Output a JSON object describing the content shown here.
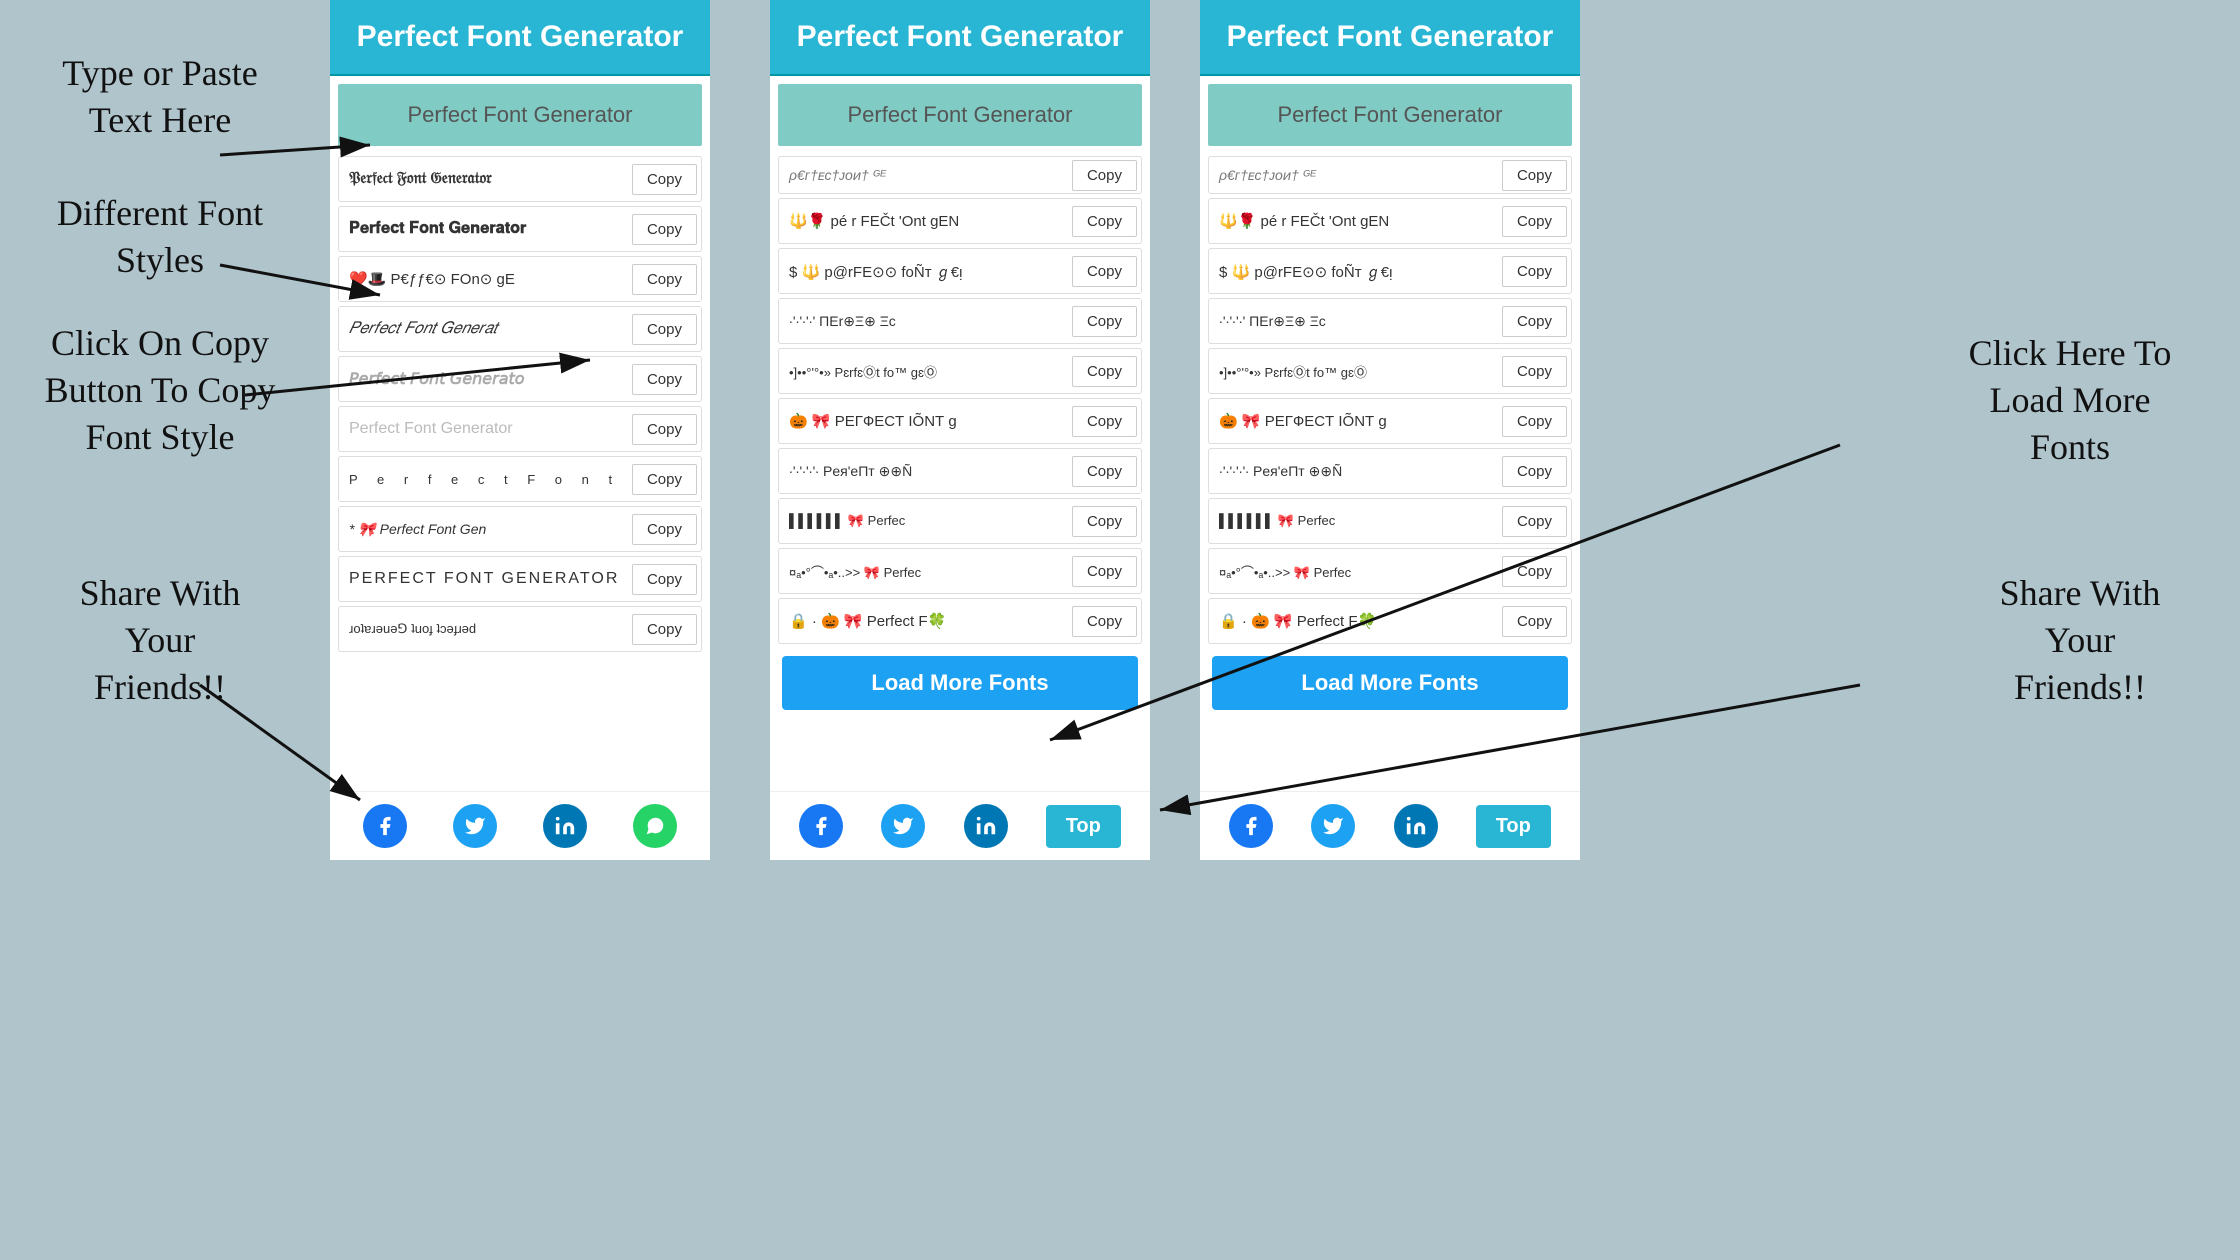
{
  "app": {
    "title": "Perfect Font Generator",
    "background_color": "#b0c4cc"
  },
  "annotations": {
    "type_paste": "Type or Paste Text\nHere",
    "different_fonts": "Different Font\nStyles",
    "click_copy": "Click On Copy\nButton To Copy\nFont Style",
    "share_left": "Share With\nYour\nFriends!!",
    "click_load": "Click Here To\nLoad More\nFonts",
    "share_right": "Share With\nYour\nFriends!!"
  },
  "left_panel": {
    "header": "Perfect Font Generator",
    "input_placeholder": "Perfect Font Generator",
    "font_rows": [
      {
        "text": "𝔓𝔢𝔯𝔣𝔢𝔠𝔱 𝔉𝔬𝔫𝔱 𝔊𝔢𝔫𝔢𝔯𝔞𝔱𝔬𝔯",
        "copy": "Copy",
        "style": "blackletter"
      },
      {
        "text": "𝐏𝐞𝐫𝐟𝐞𝐜𝐭 𝐅𝐨𝐧𝐭 𝐆𝐞𝐧𝐞𝐫𝐚𝐭𝐨𝐫",
        "copy": "Copy",
        "style": "bold"
      },
      {
        "text": "❤️🎩 P€ƒƒ€⊙ FOn⊙ gE",
        "copy": "Copy",
        "style": "emoji"
      },
      {
        "text": "𝑃𝑒𝑟𝑓𝑒𝑐𝑡 𝐹𝑜𝑛𝑡 𝐺𝑒𝑛𝑒𝑟𝑎𝑡",
        "copy": "Copy",
        "style": "italic"
      },
      {
        "text": "𝘗𝘦𝘳𝘧𝘦𝘤𝘵 𝘍𝘰𝘯𝘵 𝘎𝘦𝘯𝘦𝘳𝘢𝘵𝘰",
        "copy": "Copy",
        "style": "sans-italic"
      },
      {
        "text": "Perfect Font Generator",
        "copy": "Copy",
        "style": "faded"
      },
      {
        "text": "P e r f e c t  F o n t",
        "copy": "Copy",
        "style": "spaced"
      },
      {
        "text": "* 🎀 Perfect Font Gen",
        "copy": "Copy",
        "style": "decorated"
      },
      {
        "text": "PERFECT FONT GENERATOR",
        "copy": "Copy",
        "style": "caps"
      },
      {
        "text": "ɹoʇɐɹǝuǝ⅁ ʇuoɟ ʇɔǝɟɹǝd",
        "copy": "Copy",
        "style": "flipped"
      }
    ],
    "social": [
      "facebook",
      "twitter",
      "linkedin",
      "whatsapp"
    ]
  },
  "right_panel": {
    "header": "Perfect Font Generator",
    "input_placeholder": "Perfect Font Generator",
    "font_rows": [
      {
        "text": "ρ€ᴦ†ᴇᴄ†ᴊᴏᴎ† ᴳᴱ",
        "copy": "Copy",
        "style": "partial",
        "partial": true
      },
      {
        "text": "🔱🌹 pé r FEČt 'Ont gEN",
        "copy": "Copy",
        "style": "emoji2"
      },
      {
        "text": "$ 🔱 p@rFE⊙⊙ foÑт ℊ€ᴉ",
        "copy": "Copy",
        "style": "emoji3"
      },
      {
        "text": "∙'∙'∙'∙' ΠΕr⊕Ξ⊕ Ξc",
        "copy": "Copy",
        "style": "dots"
      },
      {
        "text": "•]••°'°•»  PɛrfɛⓄt fo™ gɛⓄ",
        "copy": "Copy",
        "style": "border"
      },
      {
        "text": "🎃 🎀 ΡΕГФΕCТ ΙÕΝТ g",
        "copy": "Copy",
        "style": "emoji4"
      },
      {
        "text": "∙'∙'∙'∙'∙ Pея'еΠт ⊕⊕Ñ",
        "copy": "Copy",
        "style": "dots2"
      },
      {
        "text": "▌▌▌▌▌▌ 🎀 Perfec",
        "copy": "Copy",
        "style": "bars"
      },
      {
        "text": "¤ₐ•°⌒•ₐ•..>> 🎀 Perfec",
        "copy": "Copy",
        "style": "fancy"
      },
      {
        "text": "🔒 · 🎃 🎀 Perfect F🍀",
        "copy": "Copy",
        "style": "emoji5"
      }
    ],
    "load_more": "Load More Fonts",
    "top_btn": "Top",
    "social": [
      "facebook",
      "twitter",
      "linkedin"
    ]
  },
  "buttons": {
    "copy_label": "Copy",
    "load_more_label": "Load More Fonts",
    "top_label": "Top"
  }
}
